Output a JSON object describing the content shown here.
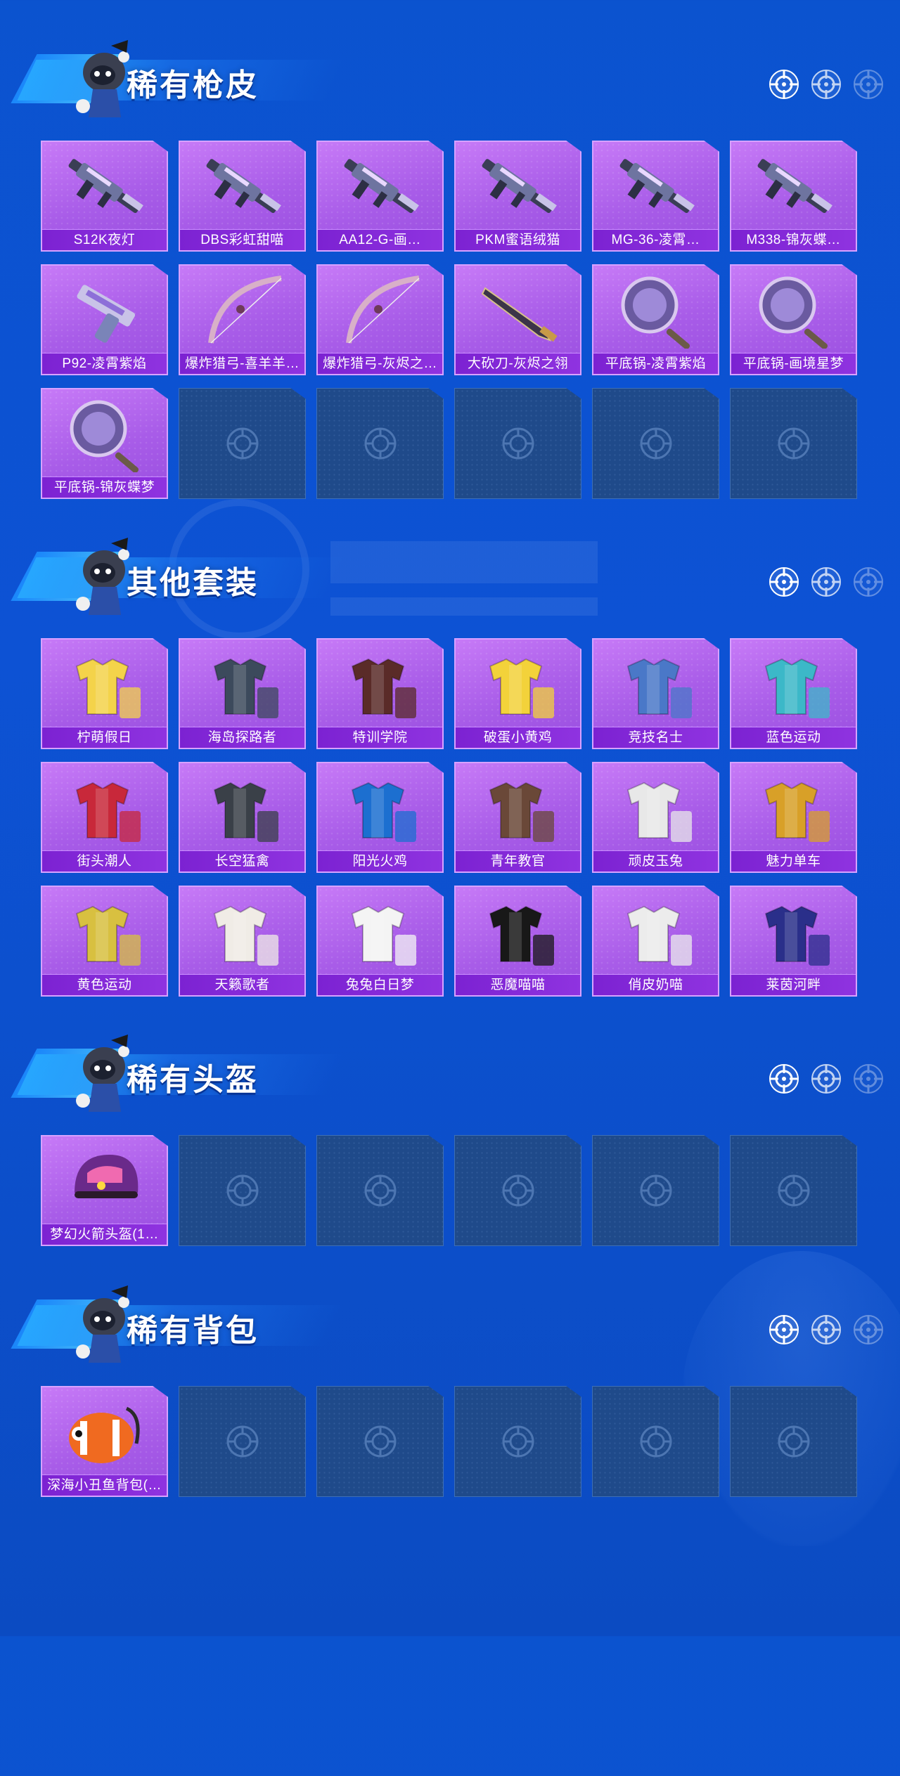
{
  "sections": [
    {
      "title": "稀有枪皮",
      "items": [
        {
          "label": "S12K夜灯",
          "art": "gun-icon"
        },
        {
          "label": "DBS彩虹甜喵",
          "art": "gun-icon"
        },
        {
          "label": "AA12-G-画…",
          "art": "gun-icon"
        },
        {
          "label": "PKM蜜语绒猫",
          "art": "gun-icon"
        },
        {
          "label": "MG-36-凌霄…",
          "art": "gun-icon"
        },
        {
          "label": "M338-锦灰蝶…",
          "art": "gun-icon"
        },
        {
          "label": "P92-凌霄紫焰",
          "art": "pistol-icon"
        },
        {
          "label": "爆炸猎弓-喜羊羊…",
          "art": "bow-icon"
        },
        {
          "label": "爆炸猎弓-灰烬之…",
          "art": "bow-icon"
        },
        {
          "label": "大砍刀-灰烬之翎",
          "art": "machete-icon"
        },
        {
          "label": "平底锅-凌霄紫焰",
          "art": "pan-icon"
        },
        {
          "label": "平底锅-画境星梦",
          "art": "pan-icon"
        },
        {
          "label": "平底锅-锦灰蝶梦",
          "art": "pan-icon"
        }
      ],
      "slots": 18
    },
    {
      "title": "其他套装",
      "items": [
        {
          "label": "柠萌假日",
          "art": "outfit-icon",
          "color": "#f4d34a"
        },
        {
          "label": "海岛探路者",
          "art": "outfit-icon",
          "color": "#3c4a5c"
        },
        {
          "label": "特训学院",
          "art": "outfit-icon",
          "color": "#5a2b28"
        },
        {
          "label": "破蛋小黄鸡",
          "art": "outfit-icon",
          "color": "#f3d23a"
        },
        {
          "label": "竞技名士",
          "art": "outfit-icon",
          "color": "#4a78c8"
        },
        {
          "label": "蓝色运动",
          "art": "outfit-icon",
          "color": "#3cb8c8"
        },
        {
          "label": "街头潮人",
          "art": "outfit-icon",
          "color": "#c8283a"
        },
        {
          "label": "长空猛禽",
          "art": "outfit-icon",
          "color": "#3a4048"
        },
        {
          "label": "阳光火鸡",
          "art": "outfit-icon",
          "color": "#1c6fd0"
        },
        {
          "label": "青年教官",
          "art": "outfit-icon",
          "color": "#6a4838"
        },
        {
          "label": "顽皮玉兔",
          "art": "outfit-icon",
          "color": "#e8e8e8"
        },
        {
          "label": "魅力单车",
          "art": "outfit-icon",
          "color": "#d8a028"
        },
        {
          "label": "黄色运动",
          "art": "outfit-icon",
          "color": "#d8c040"
        },
        {
          "label": "天籁歌者",
          "art": "outfit-icon",
          "color": "#f0ece6"
        },
        {
          "label": "兔兔白日梦",
          "art": "outfit-icon",
          "color": "#f4f4f4"
        },
        {
          "label": "恶魔喵喵",
          "art": "outfit-icon",
          "color": "#181818"
        },
        {
          "label": "俏皮奶喵",
          "art": "outfit-icon",
          "color": "#ececec"
        },
        {
          "label": "莱茵河畔",
          "art": "outfit-icon",
          "color": "#2a2f8a"
        }
      ],
      "slots": 18
    },
    {
      "title": "稀有头盔",
      "items": [
        {
          "label": "梦幻火箭头盔(1…",
          "art": "helmet-icon"
        }
      ],
      "slots": 6
    },
    {
      "title": "稀有背包",
      "items": [
        {
          "label": "深海小丑鱼背包(…",
          "art": "backpack-icon"
        }
      ],
      "slots": 6
    }
  ]
}
